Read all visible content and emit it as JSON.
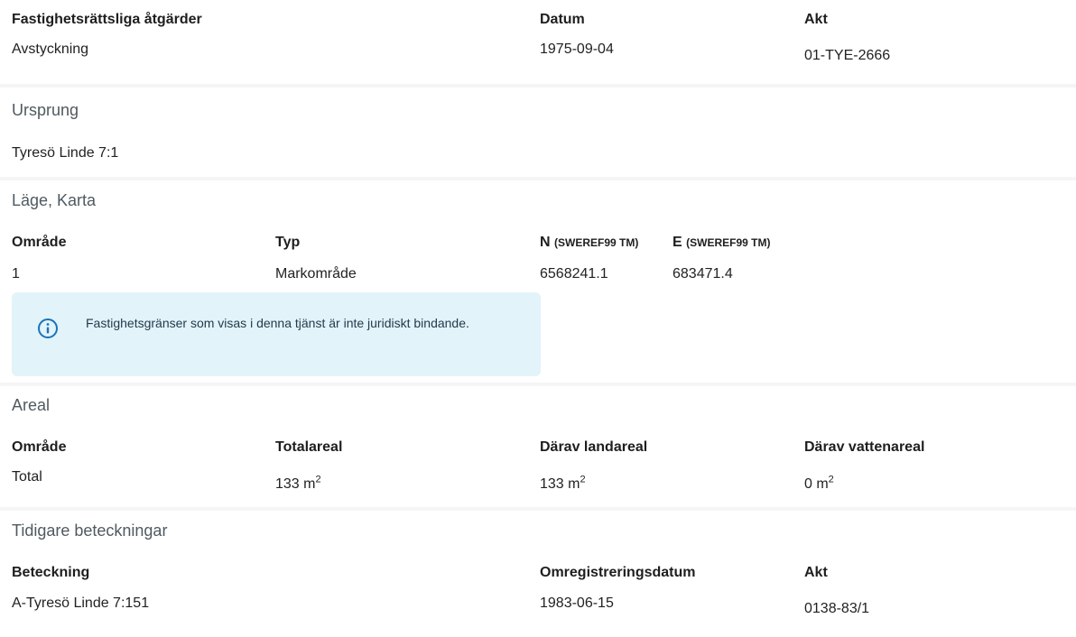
{
  "atgarder": {
    "header_action": "Fastighetsrättsliga åtgärder",
    "header_datum": "Datum",
    "header_akt": "Akt",
    "action": "Avstyckning",
    "datum": "1975-09-04",
    "akt": "01-TYE-2666"
  },
  "ursprung": {
    "title": "Ursprung",
    "value": "Tyresö Linde 7:1"
  },
  "lage": {
    "title": "Läge, Karta",
    "header_omrade": "Område",
    "header_typ": "Typ",
    "header_n": "N",
    "header_n_unit": "(SWEREF99 TM)",
    "header_e": "E",
    "header_e_unit": "(SWEREF99 TM)",
    "omrade": "1",
    "typ": "Markområde",
    "n": "6568241.1",
    "e": "683471.4",
    "info": "Fastighetsgränser som visas i denna tjänst är inte juridiskt bindande."
  },
  "areal": {
    "title": "Areal",
    "header_omrade": "Område",
    "header_total": "Totalareal",
    "header_land": "Därav landareal",
    "header_vatten": "Därav vattenareal",
    "omrade": "Total",
    "total": "133 m",
    "land": "133 m",
    "vatten": "0 m",
    "unit_exp": "2"
  },
  "tidigare": {
    "title": "Tidigare beteckningar",
    "header_beteckning": "Beteckning",
    "header_datum": "Omregistreringsdatum",
    "header_akt": "Akt",
    "beteckning": "A-Tyresö Linde 7:151",
    "datum": "1983-06-15",
    "akt": "0138-83/1"
  },
  "colors": {
    "info_bg": "#e2f3fa",
    "info_icon": "#1a73b8",
    "page_bg": "#f5f5f5"
  }
}
